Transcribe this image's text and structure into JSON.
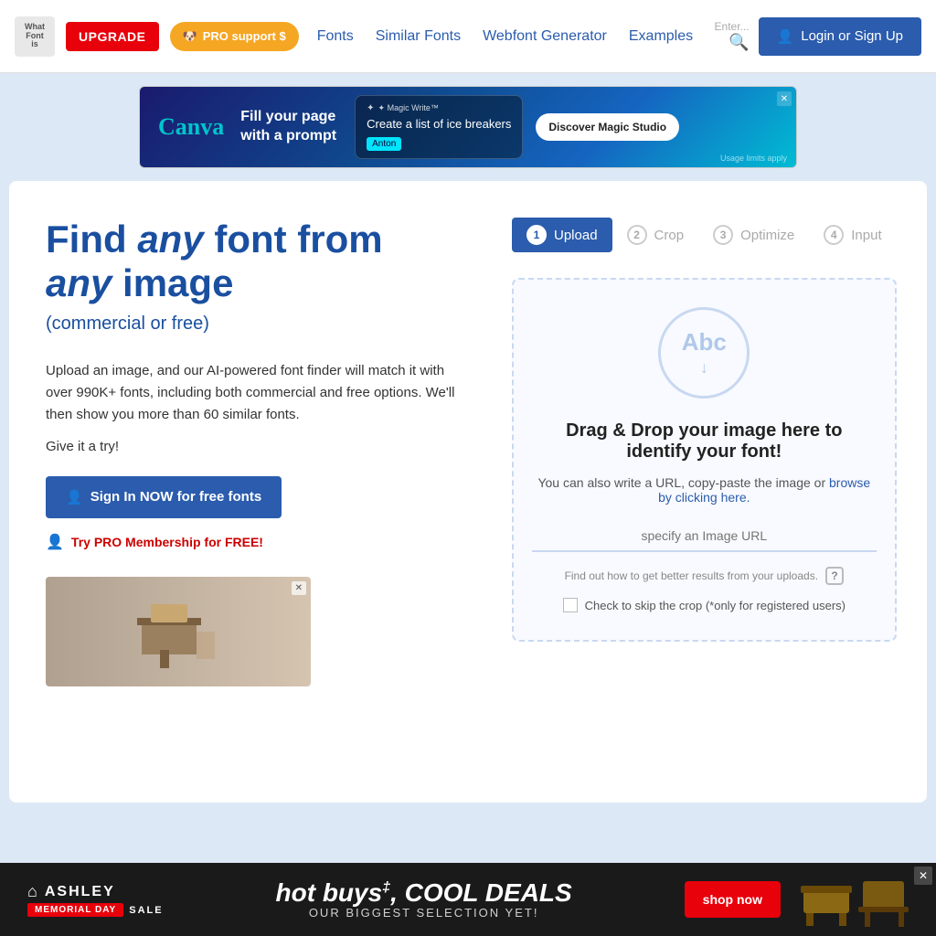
{
  "site": {
    "logo_text": "What\nFont\nis"
  },
  "navbar": {
    "upgrade_label": "UPGRADE",
    "pro_support_label": "PRO support $",
    "fonts_label": "Fonts",
    "similar_fonts_label": "Similar Fonts",
    "webfont_generator_label": "Webfont Generator",
    "examples_label": "Examples",
    "search_placeholder": "Enter...",
    "login_label": "Login or Sign Up"
  },
  "ad_banner": {
    "canva_label": "Canva",
    "tagline": "Fill your page\nwith a prompt",
    "magic_write_label": "✦ Magic Write™",
    "prompt_text": "Create a list of ice breakers",
    "tag": "Anton",
    "discover_label": "Discover Magic Studio",
    "usage": "Usage limits apply"
  },
  "hero": {
    "headline_part1": "Find ",
    "headline_italic": "any",
    "headline_part2": " font from",
    "headline_line2_italic": "any",
    "headline_line2_rest": " image",
    "subheadline": "(commercial or free)",
    "description": "Upload an image, and our AI-powered font finder will match it with over 990K+ fonts, including both commercial and free options. We'll then show you more than 60 similar fonts.",
    "give_try": "Give it a try!",
    "sign_in_label": "Sign In NOW for free fonts",
    "pro_link_label": "Try PRO Membership for FREE!"
  },
  "upload": {
    "steps": [
      {
        "num": "1",
        "label": "Upload",
        "active": true
      },
      {
        "num": "2",
        "label": "Crop",
        "active": false
      },
      {
        "num": "3",
        "label": "Optimize",
        "active": false
      },
      {
        "num": "4",
        "label": "Input",
        "active": false
      }
    ],
    "drag_drop_text": "Drag & Drop your image here to identify your font!",
    "or_text": "You can also write a URL, copy-paste the image or",
    "browse_text": "browse by clicking here.",
    "url_placeholder": "specify an Image URL",
    "better_results_text": "Find out how to get better results from your uploads.",
    "skip_crop_label": "Check to skip the crop (*only for registered users)"
  },
  "bottom_ad": {
    "brand": "ASHLEY",
    "memorial": "MEMORIAL DAY",
    "sale": "SALE",
    "hot_buys": "hot buys",
    "superscript": "‡",
    "cool_deals": ", COOL DEALS",
    "subtext": "OUR BIGGEST SELECTION YET!",
    "shop_now": "shop now"
  }
}
